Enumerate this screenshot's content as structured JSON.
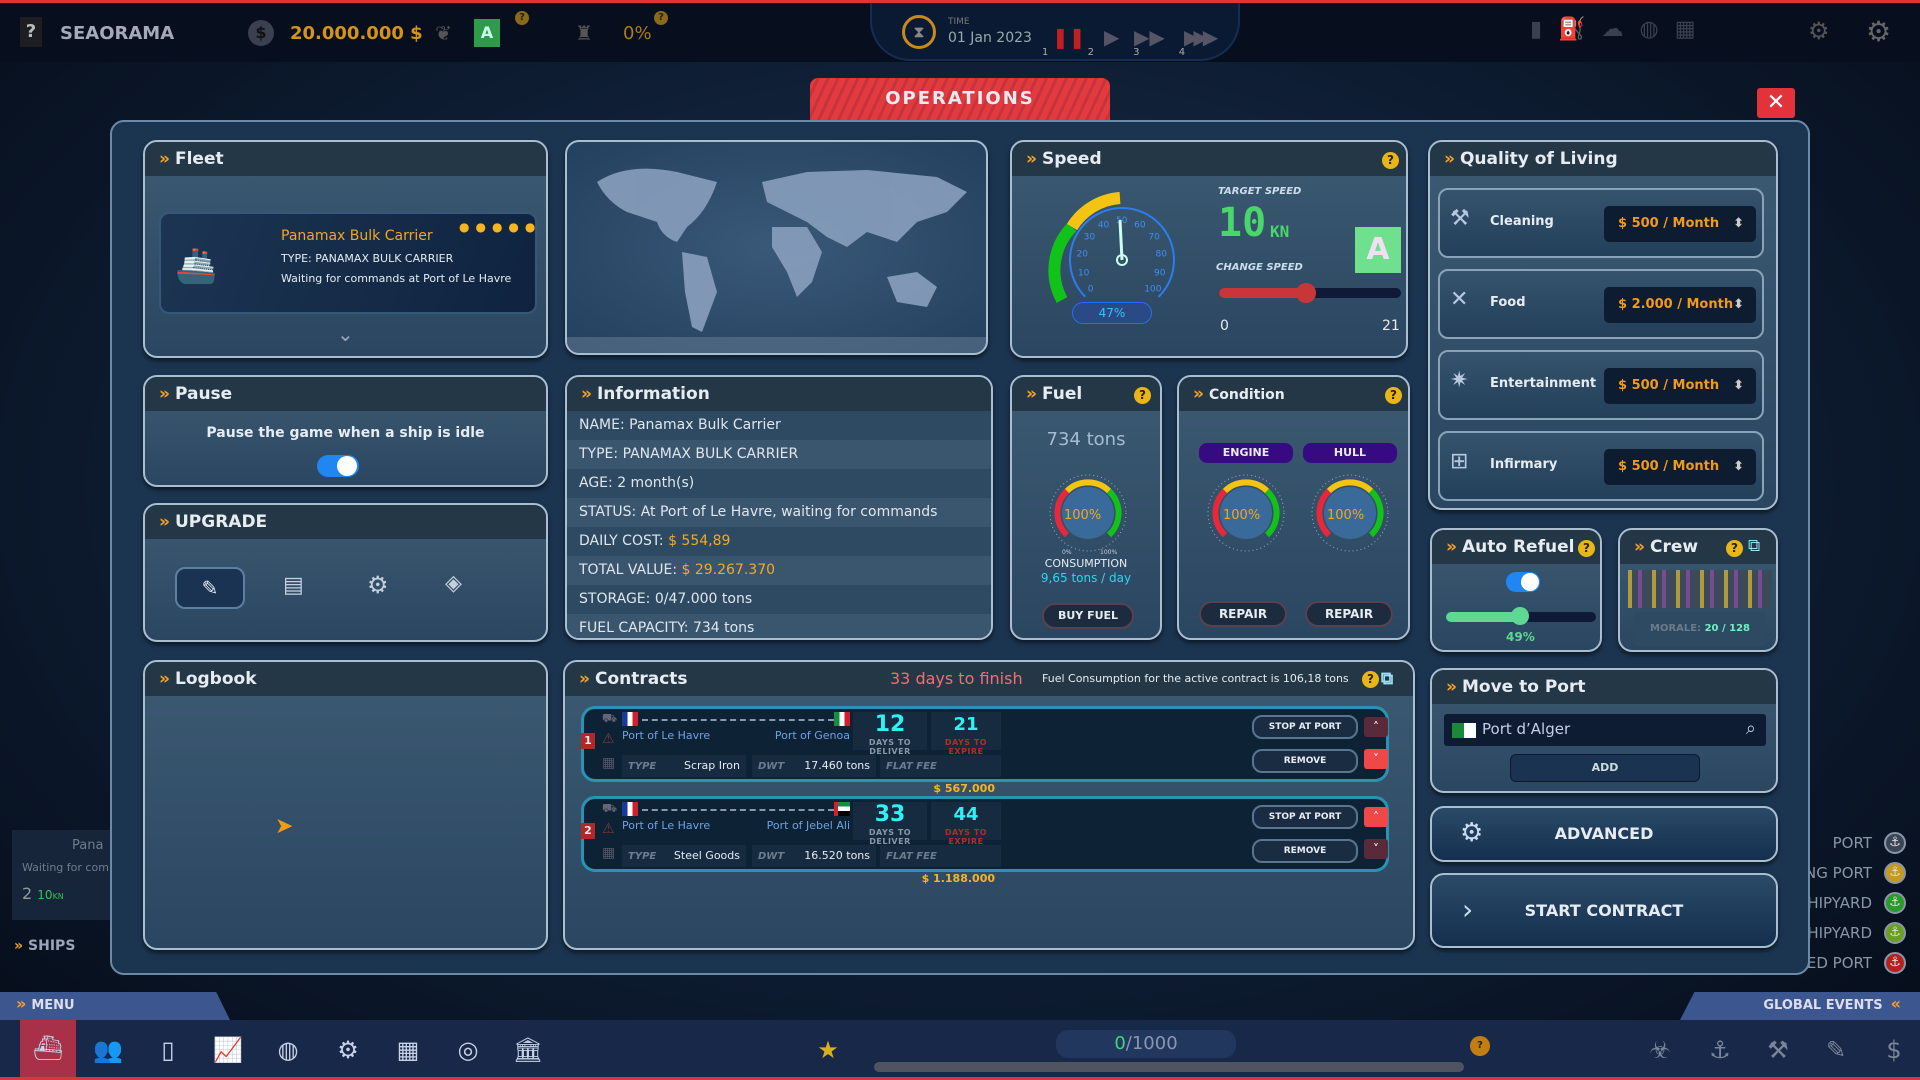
{
  "topbar": {
    "help": "?",
    "title": "SEAORAMA",
    "money": "20.000.000 $",
    "rating": "A",
    "percent": "0%",
    "time_label": "TIME",
    "date": "01 Jan 2023",
    "speeds": [
      "1",
      "2",
      "3",
      "4"
    ]
  },
  "window": {
    "title": "OPERATIONS",
    "close": "✕"
  },
  "fleet": {
    "title": "Fleet",
    "ship_name": "Panamax Bulk Carrier",
    "ship_type": "TYPE: PANAMAX BULK CARRIER",
    "status": "Waiting for commands at Port of Le Havre",
    "stars": 5
  },
  "speed": {
    "title": "Speed",
    "gauge_percent": "47%",
    "gauge_value": 47,
    "gauge_ticks": [
      "0",
      "10",
      "20",
      "30",
      "40",
      "50",
      "60",
      "70",
      "80",
      "90",
      "100"
    ],
    "target_label": "TARGET SPEED",
    "target_value": "10",
    "target_unit": "KN",
    "grade": "A",
    "change_label": "CHANGE SPEED",
    "min": "0",
    "max": "21",
    "slider_value": 10
  },
  "quality": {
    "title": "Quality of Living",
    "items": [
      {
        "label": "Cleaning",
        "value": "$ 500 / Month",
        "icon": "cleaning-icon"
      },
      {
        "label": "Food",
        "value": "$ 2.000 / Month",
        "icon": "food-icon"
      },
      {
        "label": "Entertainment",
        "value": "$ 500 / Month",
        "icon": "party-icon"
      },
      {
        "label": "Infirmary",
        "value": "$ 500 / Month",
        "icon": "first-aid-icon"
      }
    ]
  },
  "pause": {
    "title": "Pause",
    "text": "Pause the game when a ship is idle",
    "enabled": true
  },
  "upgrade": {
    "title": "UPGRADE"
  },
  "info": {
    "title": "Information",
    "rows": [
      {
        "k": "NAME:",
        "v": "Panamax Bulk Carrier"
      },
      {
        "k": "TYPE:",
        "v": "PANAMAX BULK CARRIER"
      },
      {
        "k": "AGE:",
        "v": "2 month(s)"
      },
      {
        "k": "STATUS:",
        "v": "At Port of Le Havre, waiting for commands"
      },
      {
        "k": "DAILY COST:",
        "v": "$ 554,89"
      },
      {
        "k": "TOTAL VALUE:",
        "v": "$ 29.267.370"
      },
      {
        "k": "STORAGE:",
        "v": "0/47.000 tons"
      },
      {
        "k": "FUEL CAPACITY:",
        "v": "734 tons"
      }
    ]
  },
  "fuel": {
    "title": "Fuel",
    "amount": "734 tons",
    "gauge": "100%",
    "min": "0%",
    "max": "100%",
    "consumption_label": "CONSUMPTION",
    "consumption": "9,65 tons / day",
    "buy": "BUY FUEL"
  },
  "condition": {
    "title": "Condition",
    "engine": "ENGINE",
    "hull": "HULL",
    "engine_value": "100%",
    "hull_value": "100%",
    "min": "0%",
    "max": "100%",
    "repair": "REPAIR"
  },
  "autorefuel": {
    "title": "Auto Refuel",
    "enabled": true,
    "percent": "49%",
    "value": 49
  },
  "crew": {
    "title": "Crew",
    "morale_label": "MORALE:",
    "morale": "20 / 128"
  },
  "move": {
    "title": "Move to Port",
    "port": "Port d’Alger",
    "add": "ADD"
  },
  "advanced": "ADVANCED",
  "start": "START CONTRACT",
  "logbook": {
    "title": "Logbook"
  },
  "contracts": {
    "title": "Contracts",
    "finish": "33 days to finish",
    "fuel_note": "Fuel Consumption for the active contract is 106,18 tons",
    "labels": {
      "deliver": "DAYS TO DELIVER",
      "expire": "DAYS TO EXPIRE",
      "type": "TYPE",
      "dwt": "DWT",
      "fee": "FLAT FEE",
      "stop": "STOP AT PORT",
      "remove": "REMOVE"
    },
    "items": [
      {
        "n": "1",
        "from": "Port of Le Havre",
        "to": "Port of Genoa",
        "deliver": "12",
        "expire": "21",
        "type": "Scrap Iron",
        "dwt": "17.460 tons",
        "fee": "$ 567.000"
      },
      {
        "n": "2",
        "from": "Port of Le Havre",
        "to": "Port of Jebel Ali",
        "deliver": "33",
        "expire": "44",
        "type": "Steel Goods",
        "dwt": "16.520 tons",
        "fee": "$ 1.188.000"
      }
    ]
  },
  "background": {
    "ship_name": "Pana",
    "ship_status": "Waiting for com",
    "count": "2",
    "speed": "10",
    "speed_unit": "KN",
    "ships": "SHIPS",
    "legend": [
      "PORT",
      "NG PORT",
      "HIPYARD",
      "HIPYARD",
      "SED PORT"
    ]
  },
  "bottom": {
    "menu": "MENU",
    "events": "GLOBAL EVENTS",
    "progress": "0",
    "progress_total": "/1000"
  },
  "colors": {
    "accent": "#f7a226",
    "close": "#e2333b",
    "cyan": "#2ff1f4",
    "gold": "#f6a821"
  }
}
